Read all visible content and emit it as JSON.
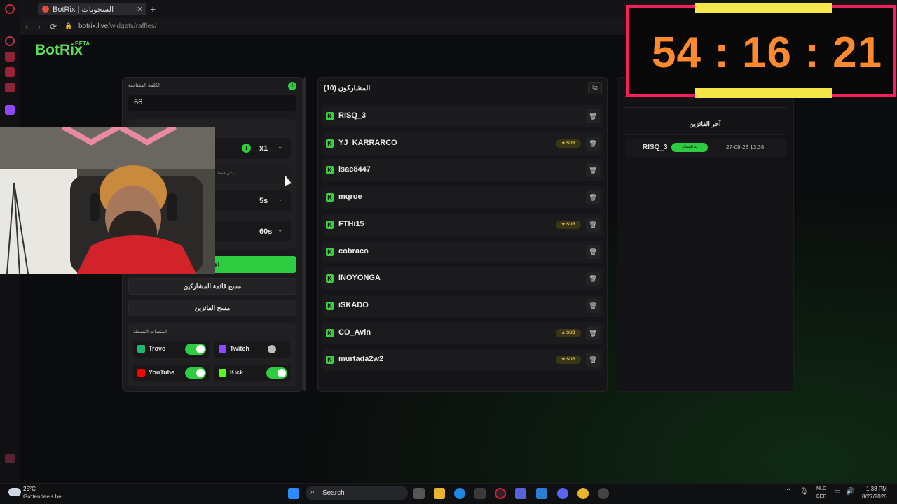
{
  "browser": {
    "tab_title": "BotRix | السحوبات",
    "url_host": "botrix.live",
    "url_path": "/widgets/raffles/",
    "new_tab_symbol": "+",
    "back_symbol": "‹",
    "forward_symbol": "›",
    "reload_symbol": "⟳",
    "lock_symbol": "🔒",
    "tab_close_symbol": "✕"
  },
  "brand": {
    "name": "BotRix",
    "badge": "BETA"
  },
  "settings": {
    "keyword_label": "الكلمة المفتاحية",
    "keyword_value": "66",
    "multiplier": "x1",
    "hint": "يمكن فقط",
    "duration_1": "5s",
    "duration_2": "60s",
    "pick_button": "اختيار",
    "clear_participants_button": "مسح قائمة المشاركين",
    "clear_winners_button": "مسح الفائزين",
    "info_symbol": "i",
    "chevron_symbol": "⌄"
  },
  "platforms": {
    "title": "المنصات النشطة",
    "items": [
      {
        "name": "Trovo",
        "enabled": true,
        "color": "#1fb86a"
      },
      {
        "name": "Twitch",
        "enabled": false,
        "color": "#9146ff"
      },
      {
        "name": "YouTube",
        "enabled": true,
        "color": "#ff0000"
      },
      {
        "name": "Kick",
        "enabled": true,
        "color": "#53fc18"
      }
    ]
  },
  "participants": {
    "title": "المشاركون (10)",
    "copy_symbol": "⧉",
    "kick_symbol": "K",
    "sub_label": "★ SUB",
    "trash_symbol": "🗑",
    "list": [
      {
        "name": "RISQ_3",
        "sub": false
      },
      {
        "name": "YJ_KARRARCO",
        "sub": true
      },
      {
        "name": "isac8447",
        "sub": false
      },
      {
        "name": "mqroe",
        "sub": false
      },
      {
        "name": "FTHi15",
        "sub": true
      },
      {
        "name": "cobraco",
        "sub": false
      },
      {
        "name": "INOYONGA",
        "sub": false
      },
      {
        "name": "iSKADO",
        "sub": false
      },
      {
        "name": "CO_Avin",
        "sub": true
      },
      {
        "name": "murtada2w2",
        "sub": true
      }
    ]
  },
  "winners": {
    "title": "آخر الفائزين",
    "list": [
      {
        "name": "RISQ_3",
        "status": "تم الاستلام",
        "time": "27-08-26 13:38"
      }
    ]
  },
  "timer": {
    "text": "54 : 16 : 21"
  },
  "taskbar": {
    "weather_temp": "25°C",
    "weather_desc": "Grotendeels be...",
    "search_placeholder": "Search",
    "search_symbol": "⌕",
    "lang_1": "NLD",
    "lang_2": "BEP",
    "time": "1:38 PM",
    "date": "8/27/2026",
    "tray_up_symbol": "⌃",
    "tray_mic_symbol": "🎙",
    "tray_net_symbol": "▭",
    "tray_sound_symbol": "🔊"
  },
  "colors": {
    "accent": "#2ecc40",
    "timer_border": "#ff1c5c",
    "timer_digits": "#ff8a2d",
    "sub_gold": "#e9c64a"
  }
}
